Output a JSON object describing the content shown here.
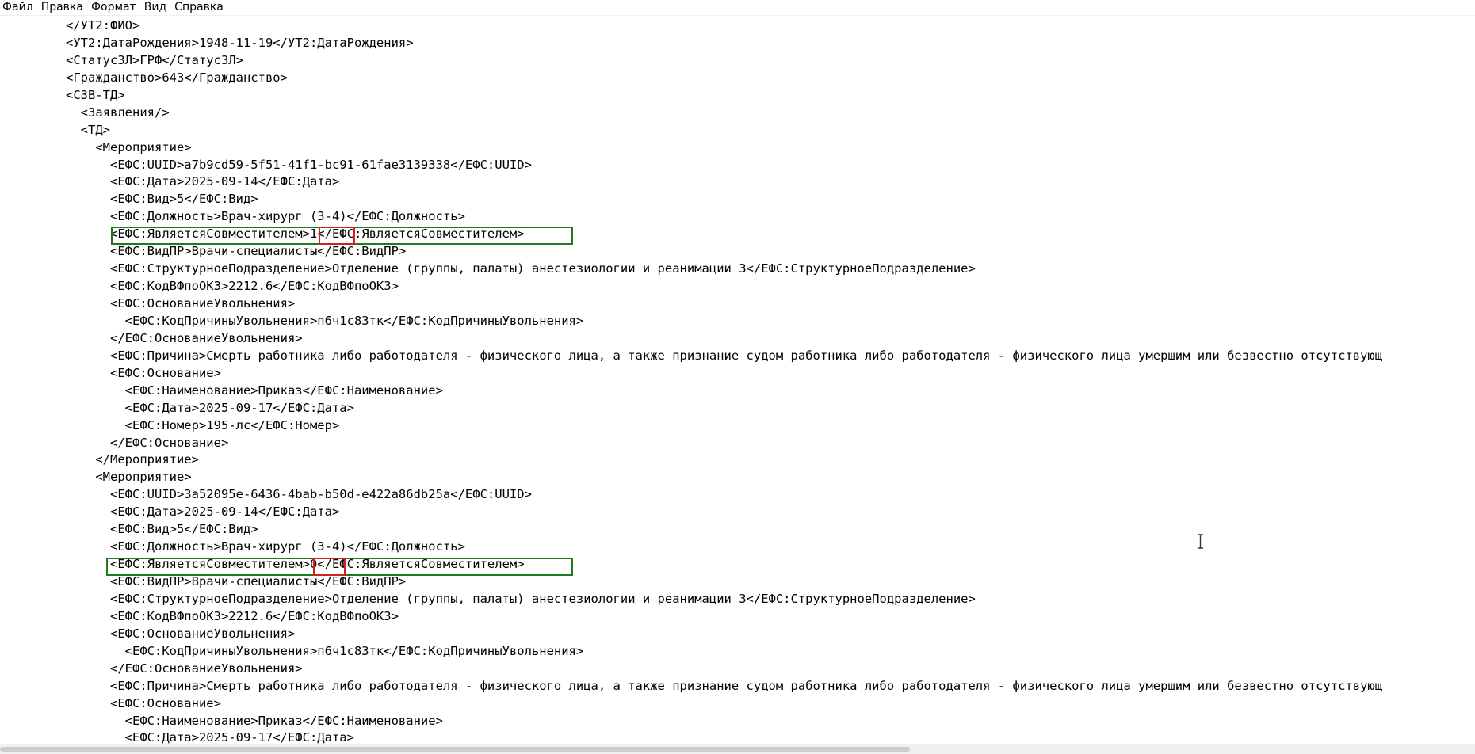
{
  "menu": {
    "items": [
      "Файл",
      "Правка",
      "Формат",
      "Вид",
      "Справка"
    ]
  },
  "editor": {
    "lines": [
      "</УТ2:ФИО>",
      "<УТ2:ДатаРождения>1948-11-19</УТ2:ДатаРождения>",
      "<СтатусЗЛ>ГРФ</СтатусЗЛ>",
      "<Гражданство>643</Гражданство>",
      "<СЗВ-ТД>",
      "  <Заявления/>",
      "  <ТД>",
      "    <Мероприятие>",
      "      <ЕФС:UUID>a7b9cd59-5f51-41f1-bc91-61fae3139338</ЕФС:UUID>",
      "      <ЕФС:Дата>2025-09-14</ЕФС:Дата>",
      "      <ЕФС:Вид>5</ЕФС:Вид>",
      "      <ЕФС:Должность>Врач-хирург (3-4)</ЕФС:Должность>",
      "      <ЕФС:ЯвляетсяСовместителем>1</ЕФС:ЯвляетсяСовместителем>",
      "      <ЕФС:ВидПР>Врачи-специалисты</ЕФС:ВидПР>",
      "      <ЕФС:СтруктурноеПодразделение>Отделение (группы, палаты) анестезиологии и реанимации 3</ЕФС:СтруктурноеПодразделение>",
      "      <ЕФС:КодВФпоОКЗ>2212.6</ЕФС:КодВФпоОКЗ>",
      "      <ЕФС:ОснованиеУвольнения>",
      "        <ЕФС:КодПричиныУвольнения>п6ч1с83тк</ЕФС:КодПричиныУвольнения>",
      "      </ЕФС:ОснованиеУвольнения>",
      "      <ЕФС:Причина>Смерть работника либо работодателя - физического лица, а также признание судом работника либо работодателя - физического лица умершим или безвестно отсутствующ",
      "      <ЕФС:Основание>",
      "        <ЕФС:Наименование>Приказ</ЕФС:Наименование>",
      "        <ЕФС:Дата>2025-09-17</ЕФС:Дата>",
      "        <ЕФС:Номер>195-лс</ЕФС:Номер>",
      "      </ЕФС:Основание>",
      "    </Мероприятие>",
      "    <Мероприятие>",
      "      <ЕФС:UUID>3a52095e-6436-4bab-b50d-e422a86db25a</ЕФС:UUID>",
      "      <ЕФС:Дата>2025-09-14</ЕФС:Дата>",
      "      <ЕФС:Вид>5</ЕФС:Вид>",
      "      <ЕФС:Должность>Врач-хирург (3-4)</ЕФС:Должность>",
      "      <ЕФС:ЯвляетсяСовместителем>0</ЕФС:ЯвляетсяСовместителем>",
      "      <ЕФС:ВидПР>Врачи-специалисты</ЕФС:ВидПР>",
      "      <ЕФС:СтруктурноеПодразделение>Отделение (группы, палаты) анестезиологии и реанимации 3</ЕФС:СтруктурноеПодразделение>",
      "      <ЕФС:КодВФпоОКЗ>2212.6</ЕФС:КодВФпоОКЗ>",
      "      <ЕФС:ОснованиеУвольнения>",
      "        <ЕФС:КодПричиныУвольнения>п6ч1с83тк</ЕФС:КодПричиныУвольнения>",
      "      </ЕФС:ОснованиеУвольнения>",
      "      <ЕФС:Причина>Смерть работника либо работодателя - физического лица, а также признание судом работника либо работодателя - физического лица умершим или безвестно отсутствующ",
      "      <ЕФС:Основание>",
      "        <ЕФС:Наименование>Приказ</ЕФС:Наименование>",
      "        <ЕФС:Дата>2025-09-17</ЕФС:Дата>"
    ]
  },
  "annotations": {
    "green_color": "#1f7a1f",
    "red_color": "#d21f1f"
  }
}
